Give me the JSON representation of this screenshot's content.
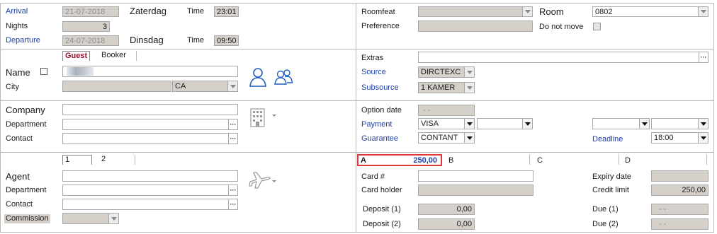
{
  "arrival": {
    "label": "Arrival",
    "date": "21-07-2018",
    "day": "Zaterdag",
    "time_label": "Time",
    "time": "23:01"
  },
  "nights": {
    "label": "Nights",
    "value": "3"
  },
  "departure": {
    "label": "Departure",
    "date": "24-07-2018",
    "day": "Dinsdag",
    "time_label": "Time",
    "time": "09:50"
  },
  "tabs_guest": {
    "guest": "Guest",
    "booker": "Booker"
  },
  "guest": {
    "name_label": "Name",
    "city_label": "City",
    "country": "CA"
  },
  "company": {
    "company_label": "Company",
    "department_label": "Department",
    "contact_label": "Contact"
  },
  "tabs_agent": {
    "t1": "1",
    "t2": "2"
  },
  "agent": {
    "agent_label": "Agent",
    "department_label": "Department",
    "contact_label": "Contact",
    "commission_label": "Commission"
  },
  "room": {
    "roomfeat_label": "Roomfeat",
    "room_label": "Room",
    "room_value": "0802",
    "preference_label": "Preference",
    "do_not_move_label": "Do not move"
  },
  "extras": {
    "extras_label": "Extras",
    "source_label": "Source",
    "source_value": "DIRCTEXC",
    "subsource_label": "Subsource",
    "subsource_value": "1 KAMER"
  },
  "option": {
    "option_date_label": "Option date",
    "option_date_value": "- -",
    "payment_label": "Payment",
    "payment_value": "VISA",
    "guarantee_label": "Guarantee",
    "guarantee_value": "CONTANT",
    "deadline_label": "Deadline",
    "deadline_value": "18:00"
  },
  "billing_tabs": {
    "a_label": "A",
    "a_amount": "250,00",
    "b_label": "B",
    "c_label": "C",
    "d_label": "D"
  },
  "card": {
    "card_no_label": "Card #",
    "card_holder_label": "Card holder",
    "expiry_label": "Expiry date",
    "credit_limit_label": "Credit limit",
    "credit_limit_value": "250,00"
  },
  "deposits": {
    "dep1_label": "Deposit (1)",
    "dep1_value": "0,00",
    "dep2_label": "Deposit (2)",
    "dep2_value": "0,00",
    "due1_label": "Due (1)",
    "due1_value": "- -",
    "due2_label": "Due (2)",
    "due2_value": "- -"
  },
  "accent": {
    "label_blue": "#1f3fa8",
    "icon_blue": "#1f5fbf",
    "highlight_red": "#e0393a",
    "guest_tab_red": "#a01030"
  }
}
